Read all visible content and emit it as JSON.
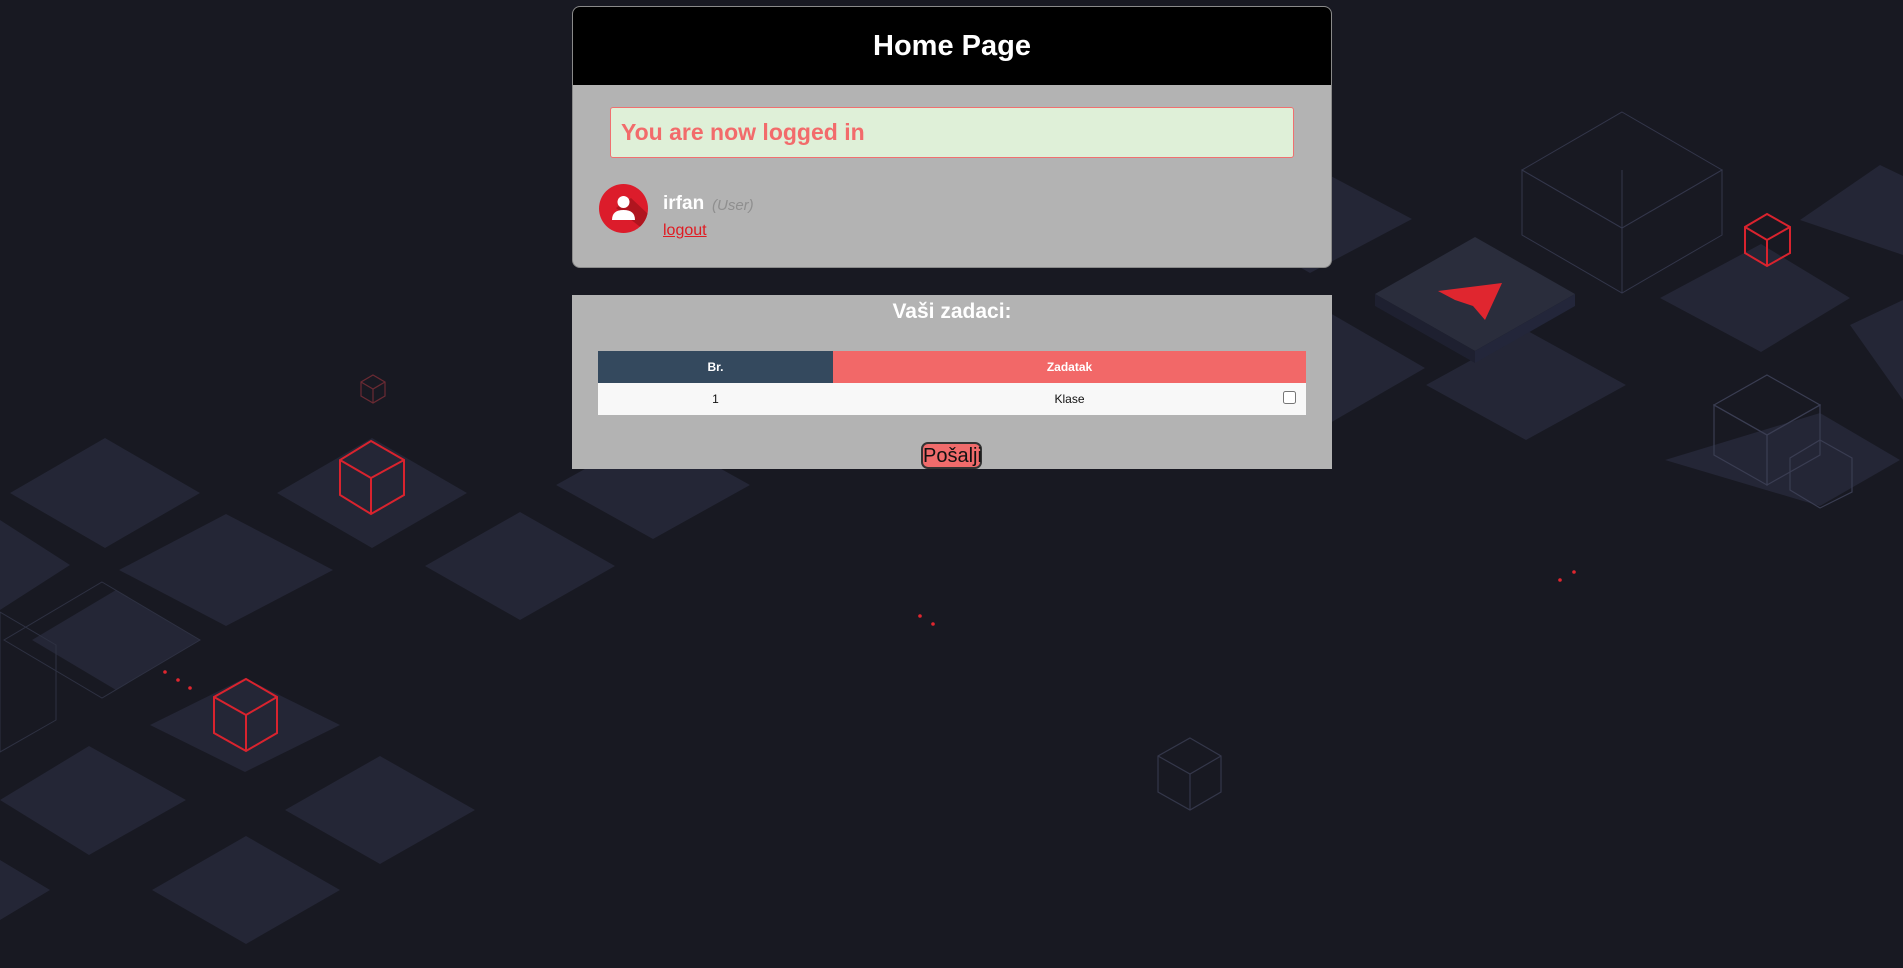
{
  "header": {
    "title": "Home Page"
  },
  "alert": {
    "message": "You are now logged in"
  },
  "user": {
    "name": "irfan",
    "role": "(User)",
    "logout_label": "logout"
  },
  "tasks": {
    "title": "Vaši zadaci:",
    "columns": [
      "Br.",
      "Zadatak"
    ],
    "rows": [
      {
        "number": "1",
        "task": "Klase",
        "checked": false
      }
    ],
    "submit_label": "Pošalji"
  },
  "colors": {
    "page_bg": "#181922",
    "card_bg": "#b3b3b3",
    "header_bg": "#000000",
    "alert_bg": "#dff0d8",
    "alert_text": "#f26b6b",
    "avatar_bg": "#dc1c2b",
    "table_head_left": "#34495e",
    "table_head_right": "#f26868",
    "accent_red": "#e01b22"
  },
  "icons": {
    "avatar": "user-icon",
    "logo": "arrow-logo-icon"
  }
}
